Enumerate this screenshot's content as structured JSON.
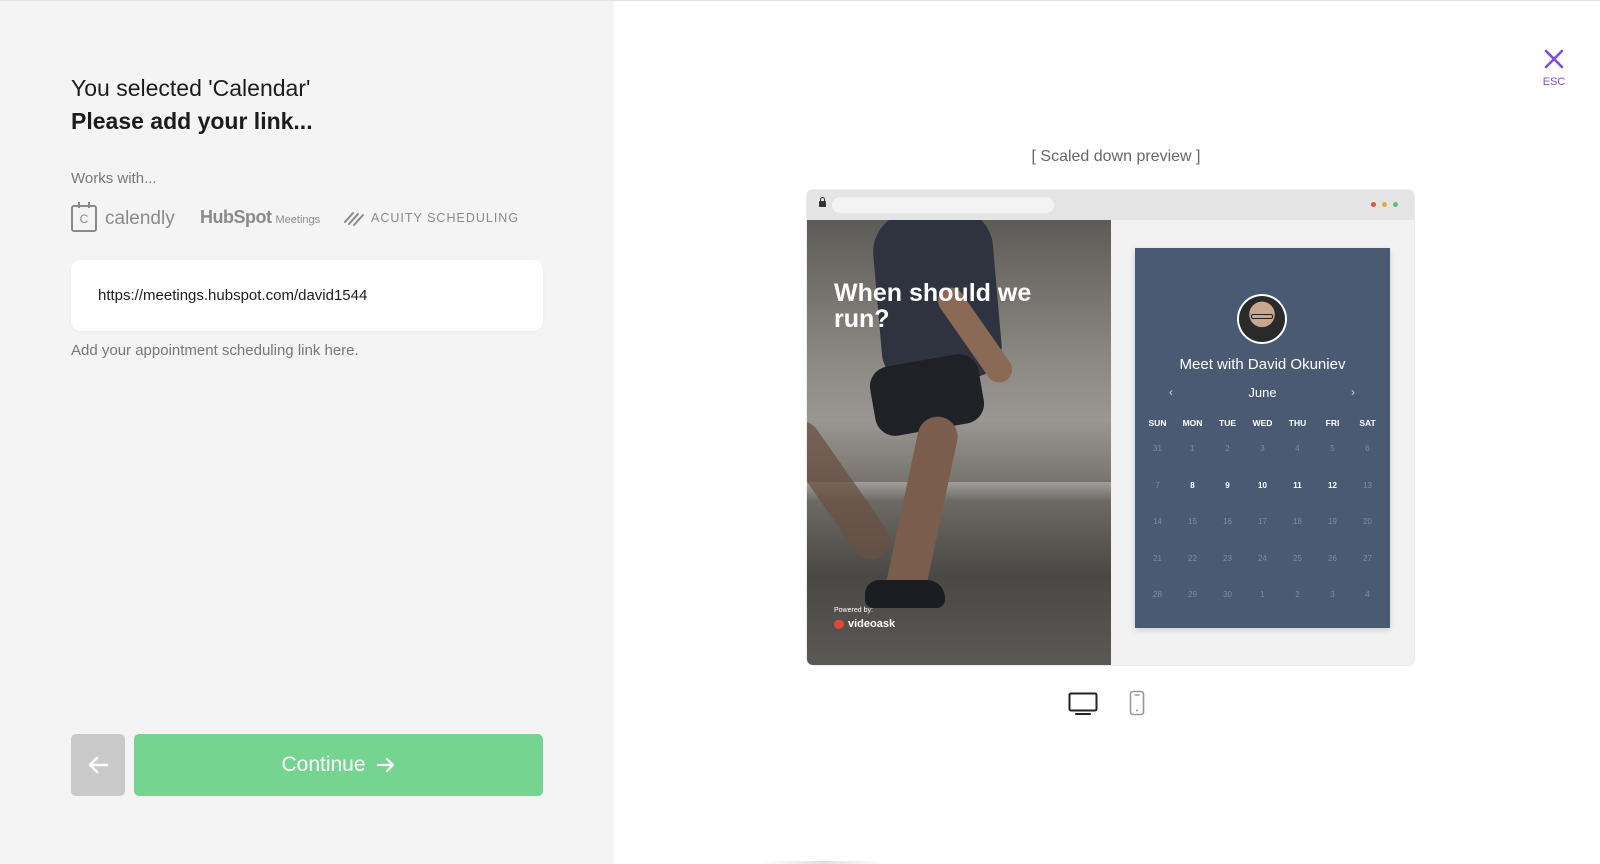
{
  "header": {
    "selected_text": "You selected 'Calendar'",
    "instruction": "Please add your link..."
  },
  "integrations": {
    "label": "Works with...",
    "calendly": "calendly",
    "calendly_icon_letter": "C",
    "hubspot": "HubSpot",
    "hubspot_sub": "Meetings",
    "acuity": "ACUITY SCHEDULING"
  },
  "link_field": {
    "value": "https://meetings.hubspot.com/david1544",
    "helper": "Add your appointment scheduling link here."
  },
  "actions": {
    "back_icon": "arrow-left-icon",
    "continue_label": "Continue",
    "continue_icon": "arrow-right-icon"
  },
  "close": {
    "label": "ESC",
    "icon": "close-icon",
    "color": "#7b4fd6"
  },
  "preview": {
    "label": "[ Scaled down preview ]",
    "window_dots": [
      "#e5533d",
      "#f0a73a",
      "#5cc46b"
    ],
    "video": {
      "heading": "When should we run?",
      "powered_by": "Powered by:",
      "brand": "videoask"
    },
    "calendar": {
      "title": "Meet with David Okuniev",
      "month": "June",
      "prev": "‹",
      "next": "›",
      "days": [
        "SUN",
        "MON",
        "TUE",
        "WED",
        "THU",
        "FRI",
        "SAT"
      ],
      "weeks": [
        [
          "31",
          "1",
          "2",
          "3",
          "4",
          "5",
          "6"
        ],
        [
          "7",
          "8",
          "9",
          "10",
          "11",
          "12",
          "13"
        ],
        [
          "14",
          "15",
          "16",
          "17",
          "18",
          "19",
          "20"
        ],
        [
          "21",
          "22",
          "23",
          "24",
          "25",
          "26",
          "27"
        ],
        [
          "28",
          "29",
          "30",
          "1",
          "2",
          "3",
          "4"
        ]
      ],
      "available": [
        "8",
        "9",
        "10",
        "11",
        "12"
      ],
      "card_color": "#4b5a73"
    },
    "devices": [
      "desktop-icon",
      "mobile-icon"
    ]
  },
  "colors": {
    "continue": "#74d490",
    "back": "#c9c9c9",
    "left_panel": "#f4f4f4"
  }
}
